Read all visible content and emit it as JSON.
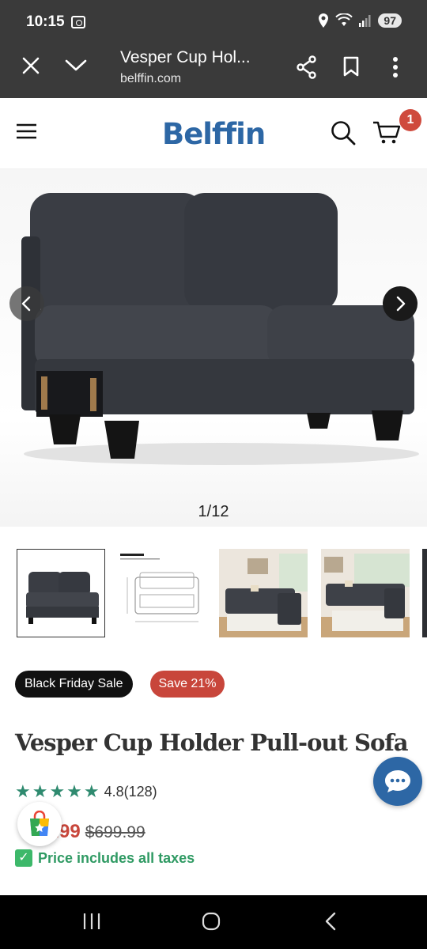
{
  "status_bar": {
    "time": "10:15",
    "battery": "97"
  },
  "browser": {
    "page_title": "Vesper Cup Hol...",
    "url": "belffin.com"
  },
  "header": {
    "logo": "Belffin",
    "cart_count": "1"
  },
  "gallery": {
    "counter": "1/12"
  },
  "badges": {
    "sale": "Black Friday Sale",
    "save": "Save 21%"
  },
  "product": {
    "title": "Vesper Cup Holder Pull-out Sofa",
    "rating": "4.8(128)",
    "price_visible": ".99",
    "price_partial_prefix": "$",
    "price_original": "$699.99",
    "tax_note": "Price includes all taxes"
  },
  "colors": {
    "brand": "#2d67a5",
    "sale_red": "#c8463b",
    "star_green": "#2f8a6f",
    "tax_green": "#2f9a63"
  }
}
